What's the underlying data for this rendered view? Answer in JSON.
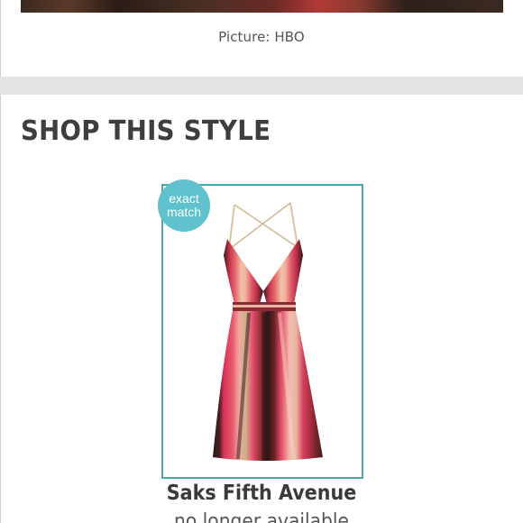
{
  "hero": {
    "caption": "Picture: HBO"
  },
  "section": {
    "title": "SHOP THIS STYLE"
  },
  "product": {
    "badge_line1": "exact",
    "badge_line2": "match",
    "brand": "Saks Fifth Avenue",
    "availability": "no longer available",
    "image_icon": "striped-dress-image"
  },
  "colors": {
    "accent": "#4fa6a8",
    "badge": "#5fc1cc",
    "band": "#e3e3e3",
    "title": "#3e3e3e"
  }
}
